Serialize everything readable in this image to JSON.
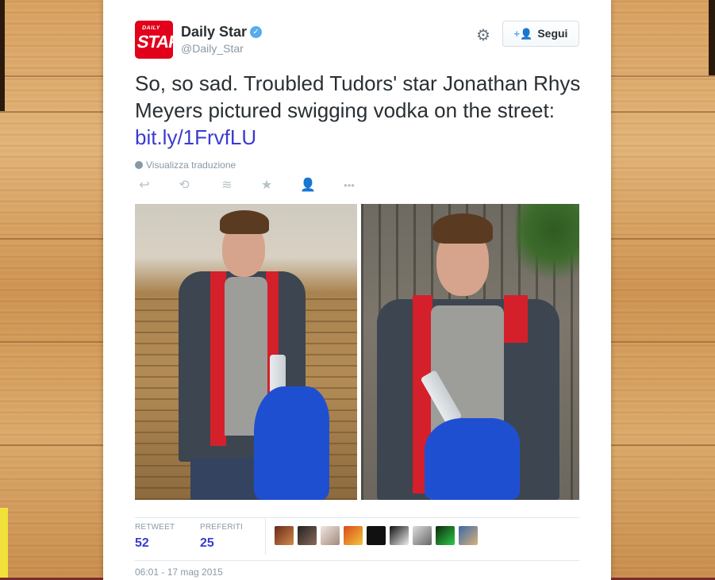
{
  "tweet": {
    "author": {
      "display_name": "Daily Star",
      "handle": "@Daily_Star",
      "avatar_text_top": "DAILY",
      "avatar_text_main": "STAR",
      "verified": true
    },
    "follow_label": "Segui",
    "text": "So, so sad. Troubled Tudors' star Jonathan Rhys Meyers pictured swigging vodka on the street: ",
    "link": "bit.ly/1FrvfLU",
    "translate_label": "Visualizza traduzione",
    "actions": [
      {
        "name": "reply-icon",
        "glyph": "↩"
      },
      {
        "name": "retweet-icon",
        "glyph": "⟲"
      },
      {
        "name": "buffer-icon",
        "glyph": "≋"
      },
      {
        "name": "favorite-icon",
        "glyph": "★"
      },
      {
        "name": "follow-user-icon",
        "glyph": "👤"
      },
      {
        "name": "more-icon",
        "glyph": "•••"
      }
    ],
    "stats": {
      "retweets_label": "RETWEET",
      "retweets_value": "52",
      "favorites_label": "PREFERITI",
      "favorites_value": "25"
    },
    "favoriters_count_shown": 10,
    "timestamp": "06:01 - 17 mag 2015"
  },
  "colors": {
    "brand_red": "#e2001a",
    "link": "#3a3bd1",
    "verified_blue": "#55acee",
    "muted": "#8899a6"
  }
}
